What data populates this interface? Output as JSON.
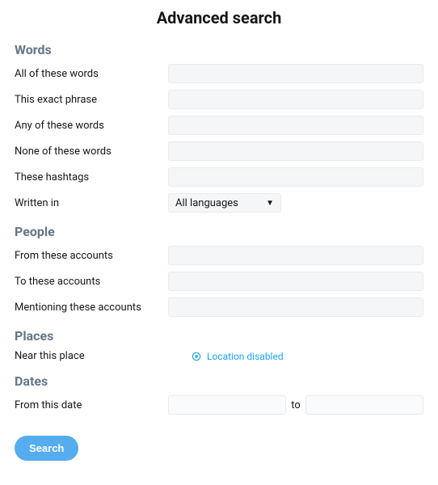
{
  "title": "Advanced search",
  "sections": {
    "words": {
      "header": "Words",
      "all": "All of these words",
      "exact": "This exact phrase",
      "any": "Any of these words",
      "none": "None of these words",
      "hashtags": "These hashtags",
      "written_in": "Written in",
      "language_selected": "All languages"
    },
    "people": {
      "header": "People",
      "from": "From these accounts",
      "to": "To these accounts",
      "mentioning": "Mentioning these accounts"
    },
    "places": {
      "header": "Places",
      "near": "Near this place",
      "location_status": "Location disabled"
    },
    "dates": {
      "header": "Dates",
      "from_date": "From this date",
      "to": "to"
    }
  },
  "buttons": {
    "search": "Search"
  }
}
